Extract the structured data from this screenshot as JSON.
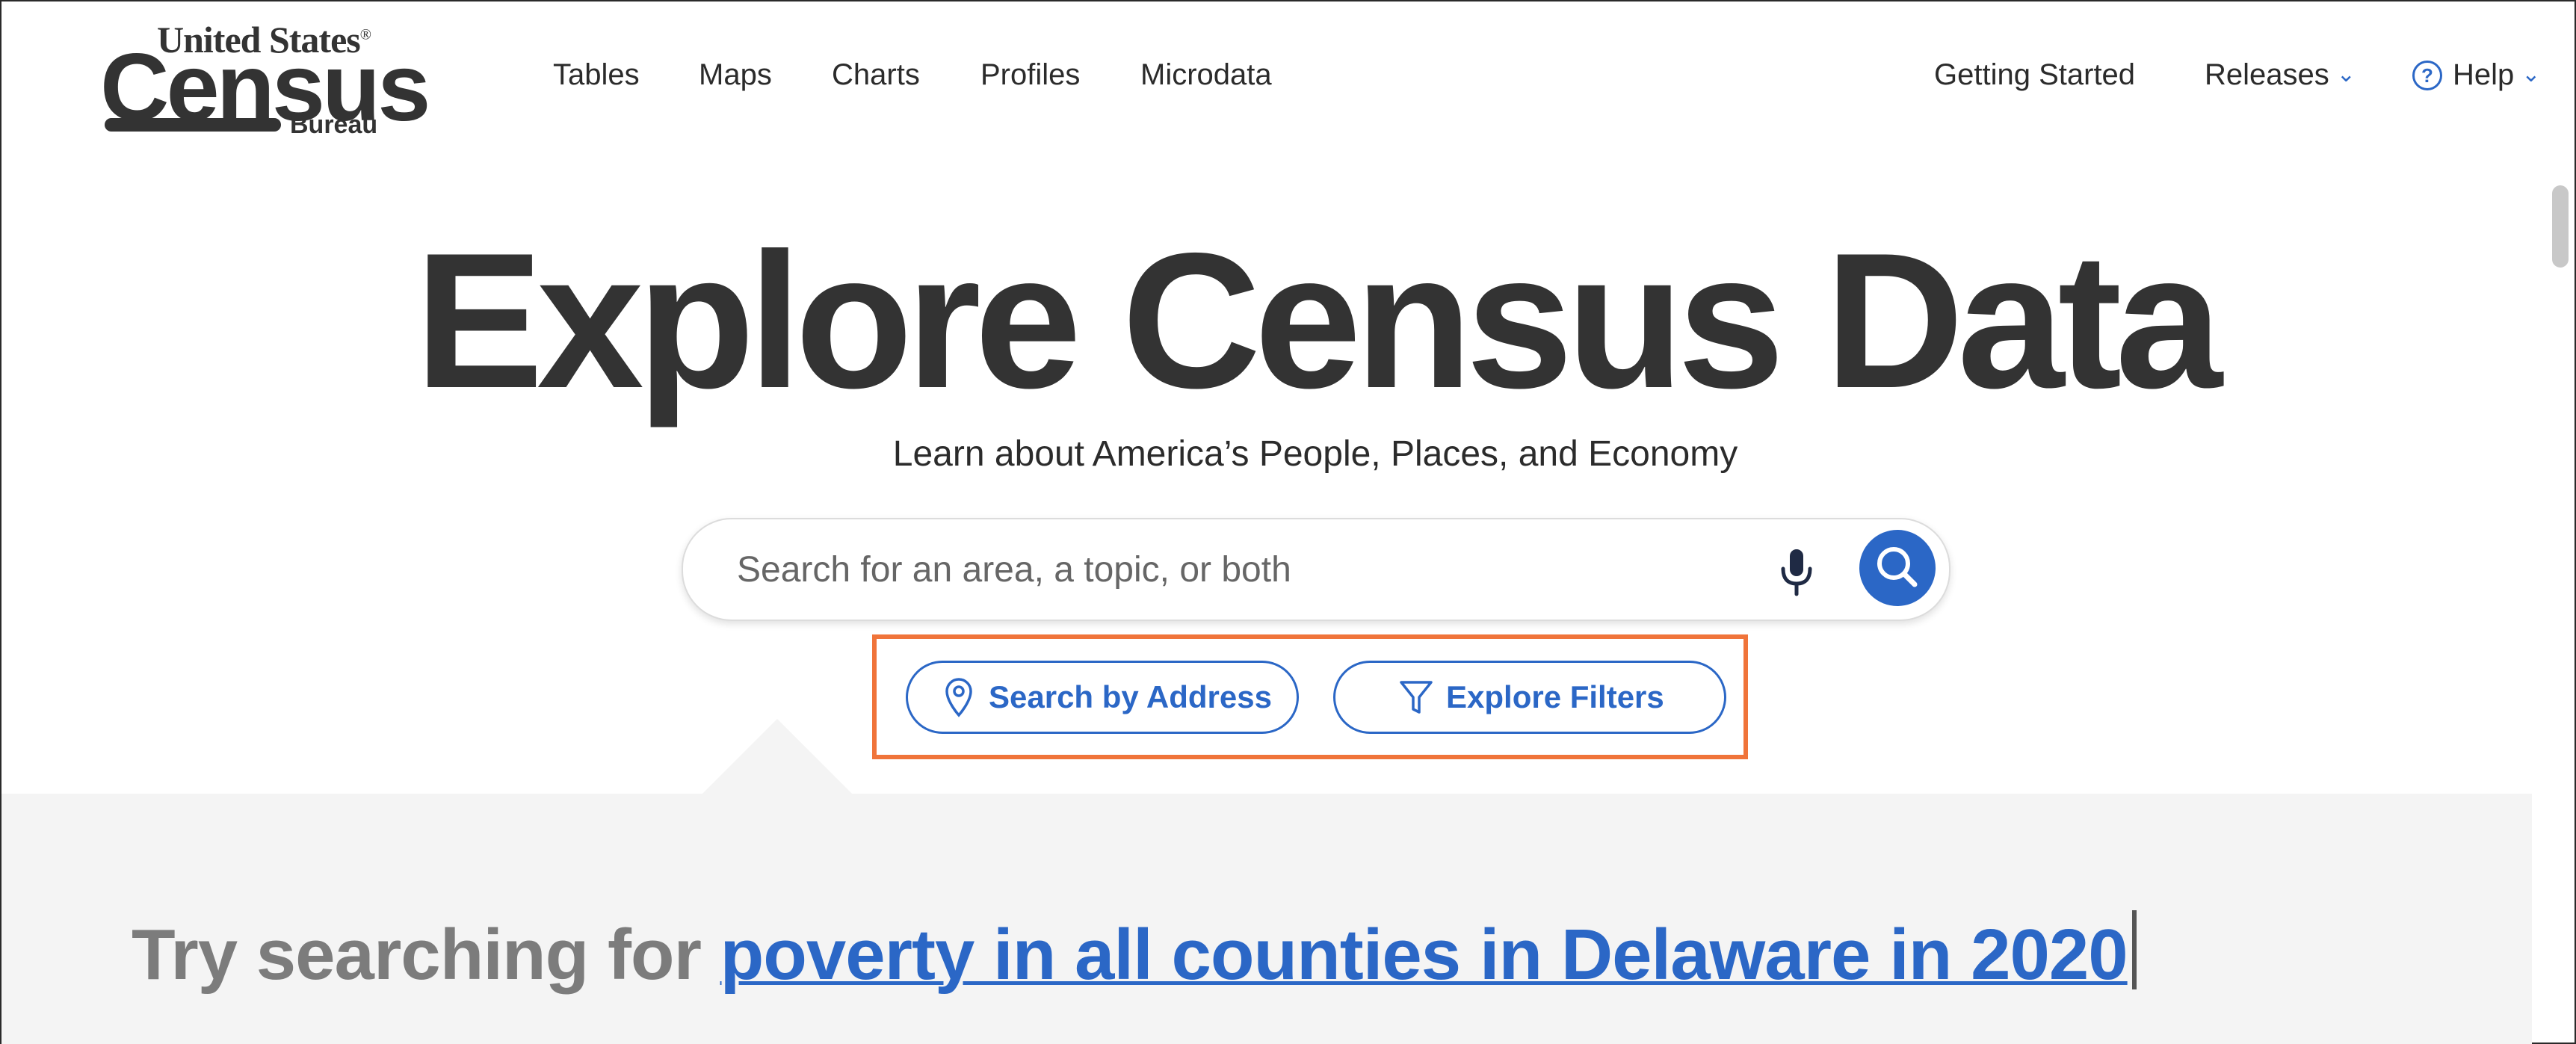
{
  "logo": {
    "line1": "United States",
    "registered": "®",
    "line2": "Census",
    "line3": "Bureau"
  },
  "nav": {
    "left": [
      "Tables",
      "Maps",
      "Charts",
      "Profiles",
      "Microdata"
    ],
    "getting_started": "Getting Started",
    "releases": "Releases",
    "help": "Help",
    "help_glyph": "?",
    "chevron": "⌄"
  },
  "hero": {
    "title": "Explore Census Data",
    "subtitle": "Learn about America’s People, Places, and Economy"
  },
  "search": {
    "placeholder": "Search for an area, a topic, or both",
    "value": ""
  },
  "actions": {
    "search_by_address": "Search by Address",
    "explore_filters": "Explore Filters"
  },
  "suggestion": {
    "prefix": "Try searching for ",
    "link": "poverty in all counties in Delaware in 2020"
  },
  "colors": {
    "accent": "#2b67c6",
    "highlight": "#f0743a",
    "panel": "#f4f4f4",
    "text": "#333333"
  }
}
